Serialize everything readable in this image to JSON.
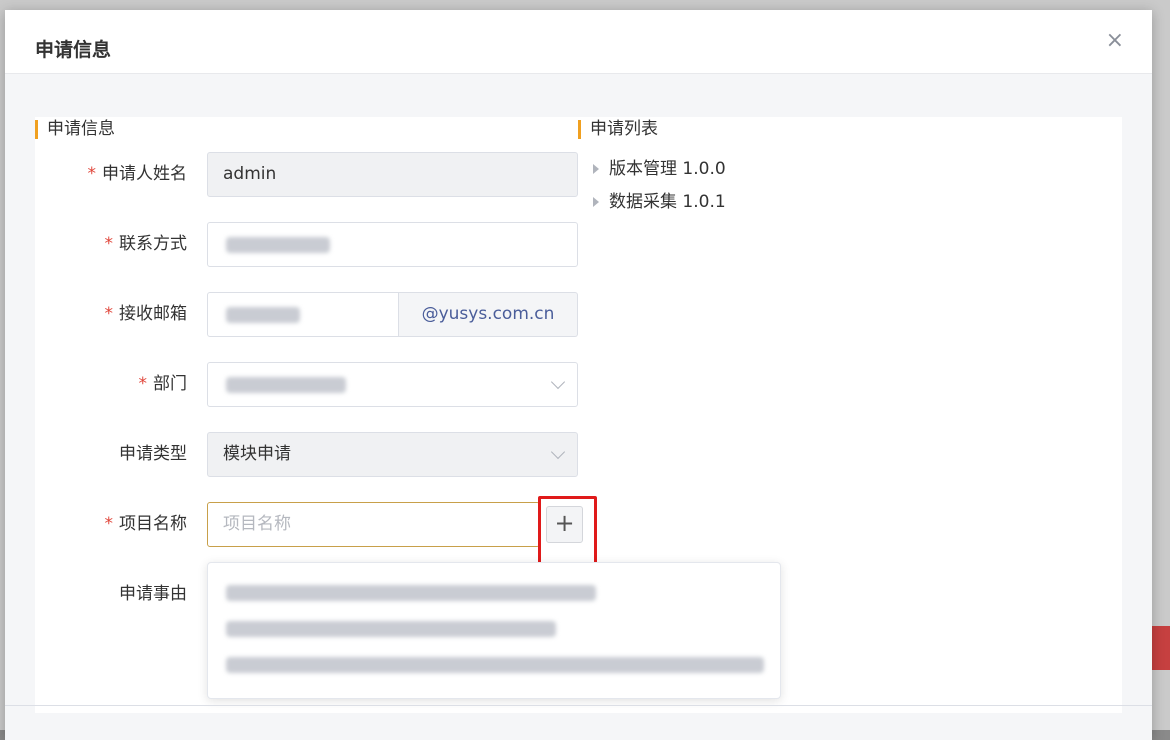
{
  "dialog": {
    "title": "申请信息",
    "close_symbol": "×"
  },
  "form_section": {
    "title": "申请信息",
    "fields": {
      "applicant_name": {
        "label": "申请人姓名",
        "value": "admin",
        "required": true
      },
      "contact": {
        "label": "联系方式",
        "required": true
      },
      "email": {
        "label": "接收邮箱",
        "suffix": "@yusys.com.cn",
        "required": true
      },
      "department": {
        "label": "部门",
        "required": true
      },
      "apply_type": {
        "label": "申请类型",
        "value": "模块申请",
        "required": false
      },
      "project_name": {
        "label": "项目名称",
        "placeholder": "项目名称",
        "required": true
      },
      "reason": {
        "label": "申请事由",
        "required": false
      }
    },
    "add_button_symbol": "+",
    "required_mark": "*"
  },
  "list_section": {
    "title": "申请列表",
    "items": [
      {
        "label": "版本管理 1.0.0"
      },
      {
        "label": "数据采集 1.0.1"
      }
    ]
  },
  "colors": {
    "accent_bar": "#f0a020",
    "required": "#e0453a",
    "highlight": "#e01a1a",
    "suffix_text": "#4a5d9a"
  },
  "icons": [
    "close-icon",
    "chevron-down-icon",
    "plus-icon",
    "caret-right-icon"
  ]
}
